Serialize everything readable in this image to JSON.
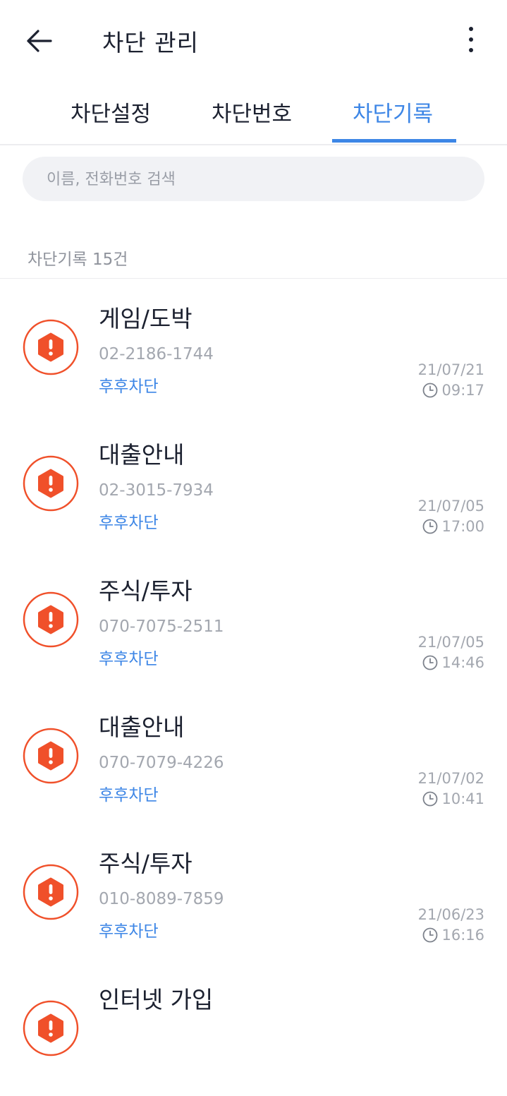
{
  "header": {
    "title": "차단 관리"
  },
  "tabs": [
    {
      "label": "차단설정",
      "active": false
    },
    {
      "label": "차단번호",
      "active": false
    },
    {
      "label": "차단기록",
      "active": true
    }
  ],
  "search": {
    "placeholder": "이름, 전화번호 검색",
    "value": ""
  },
  "list": {
    "count_label": "차단기록 15건",
    "items": [
      {
        "category": "게임/도박",
        "phone": "02-2186-1744",
        "source": "후후차단",
        "date": "21/07/21",
        "time": "09:17"
      },
      {
        "category": "대출안내",
        "phone": "02-3015-7934",
        "source": "후후차단",
        "date": "21/07/05",
        "time": "17:00"
      },
      {
        "category": "주식/투자",
        "phone": "070-7075-2511",
        "source": "후후차단",
        "date": "21/07/05",
        "time": "14:46"
      },
      {
        "category": "대출안내",
        "phone": "070-7079-4226",
        "source": "후후차단",
        "date": "21/07/02",
        "time": "10:41"
      },
      {
        "category": "주식/투자",
        "phone": "010-8089-7859",
        "source": "후후차단",
        "date": "21/06/23",
        "time": "16:16"
      },
      {
        "category": "인터넷 가입",
        "phone": "",
        "source": "",
        "date": "",
        "time": ""
      }
    ]
  },
  "colors": {
    "accent": "#3d86e6",
    "warning": "#f0502a",
    "text": "#1c2130",
    "muted": "#a3a7af"
  },
  "icons": {
    "back": "arrow-left-icon",
    "more": "more-vertical-icon",
    "row": "warning-hexagon-icon",
    "time": "clock-icon"
  }
}
